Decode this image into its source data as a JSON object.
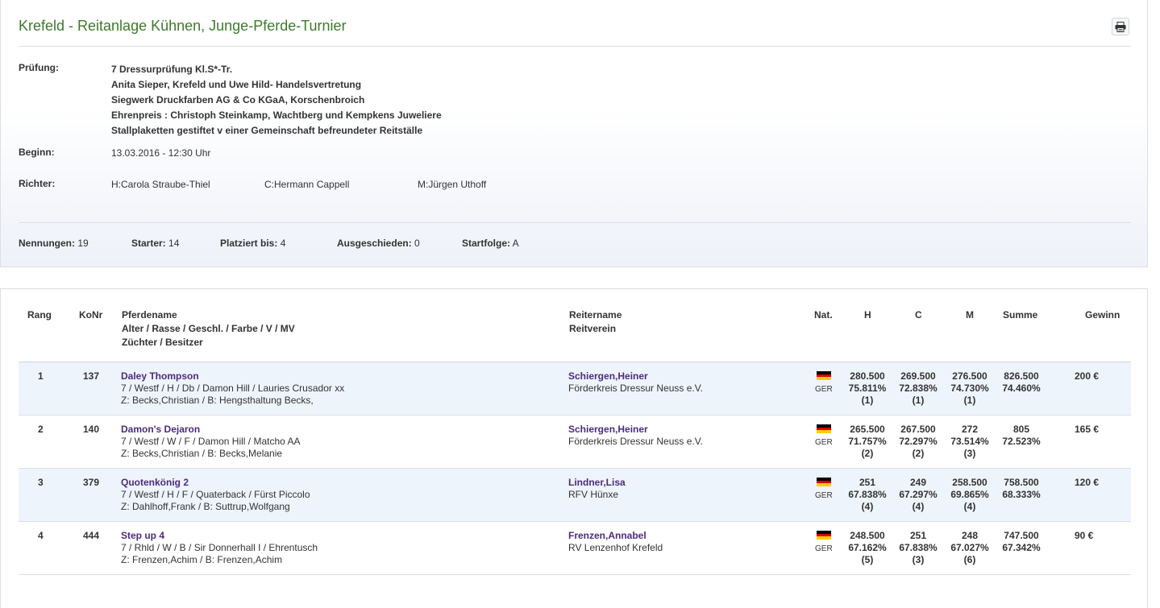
{
  "title": "Krefeld - Reitanlage Kühnen, Junge-Pferde-Turnier",
  "info": {
    "pruefung_label": "Prüfung:",
    "pruefung_lines": [
      "7 Dressurprüfung Kl.S*-Tr.",
      "Anita Sieper, Krefeld und Uwe Hild- Handelsvertretung",
      "Siegwerk Druckfarben AG & Co KGaA, Korschenbroich",
      "Ehrenpreis : Christoph Steinkamp, Wachtberg und Kempkens Juweliere",
      "Stallplaketten gestiftet v einer Gemeinschaft befreundeter Reitställe"
    ],
    "beginn_label": "Beginn:",
    "beginn_value": "13.03.2016 - 12:30 Uhr",
    "richter_label": "Richter:",
    "richter": [
      "H:Carola Straube-Thiel",
      "C:Hermann Cappell",
      "M:Jürgen Uthoff"
    ]
  },
  "stats": [
    {
      "label": "Nennungen:",
      "value": "19"
    },
    {
      "label": "Starter:",
      "value": "14"
    },
    {
      "label": "Platziert bis:",
      "value": "4"
    },
    {
      "label": "Ausgeschieden:",
      "value": "0"
    },
    {
      "label": "Startfolge:",
      "value": "A"
    }
  ],
  "table": {
    "headers": {
      "rang": "Rang",
      "konr": "KoNr",
      "pferd1": "Pferdename",
      "pferd2": "Alter / Rasse / Geschl. / Farbe / V / MV",
      "pferd3": "Züchter / Besitzer",
      "reiter1": "Reitername",
      "reiter2": "Reitverein",
      "nat": "Nat.",
      "h": "H",
      "c": "C",
      "m": "M",
      "summe": "Summe",
      "gewinn": "Gewinn"
    },
    "rows": [
      {
        "rang": "1",
        "konr": "137",
        "pferd": "Daley Thompson",
        "details": "7 / Westf / H / Db / Damon Hill / Lauries Crusador xx",
        "zb": "Z: Becks,Christian / B: Hengsthaltung Becks,",
        "reiter": "Schiergen,Heiner",
        "verein": "Förderkreis Dressur Neuss e.V.",
        "nat": "GER",
        "h": [
          "280.500",
          "75.811%",
          "(1)"
        ],
        "c": [
          "269.500",
          "72.838%",
          "(1)"
        ],
        "m": [
          "276.500",
          "74.730%",
          "(1)"
        ],
        "summe": [
          "826.500",
          "74.460%"
        ],
        "gewinn": "200 €"
      },
      {
        "rang": "2",
        "konr": "140",
        "pferd": "Damon's Dejaron",
        "details": "7 / Westf / W / F / Damon Hill / Matcho AA",
        "zb": "Z: Becks,Christian / B: Becks,Melanie",
        "reiter": "Schiergen,Heiner",
        "verein": "Förderkreis Dressur Neuss e.V.",
        "nat": "GER",
        "h": [
          "265.500",
          "71.757%",
          "(2)"
        ],
        "c": [
          "267.500",
          "72.297%",
          "(2)"
        ],
        "m": [
          "272",
          "73.514%",
          "(3)"
        ],
        "summe": [
          "805",
          "72.523%"
        ],
        "gewinn": "165 €"
      },
      {
        "rang": "3",
        "konr": "379",
        "pferd": "Quotenkönig 2",
        "details": "7 / Westf / H / F / Quaterback / Fürst Piccolo",
        "zb": "Z: Dahlhoff,Frank / B: Suttrup,Wolfgang",
        "reiter": "Lindner,Lisa",
        "verein": "RFV Hünxe",
        "nat": "GER",
        "h": [
          "251",
          "67.838%",
          "(4)"
        ],
        "c": [
          "249",
          "67.297%",
          "(4)"
        ],
        "m": [
          "258.500",
          "69.865%",
          "(4)"
        ],
        "summe": [
          "758.500",
          "68.333%"
        ],
        "gewinn": "120 €"
      },
      {
        "rang": "4",
        "konr": "444",
        "pferd": "Step up 4",
        "details": "7 / Rhld / W / B / Sir Donnerhall I / Ehrentusch",
        "zb": "Z: Frenzen,Achim / B: Frenzen,Achim",
        "reiter": "Frenzen,Annabel",
        "verein": "RV Lenzenhof Krefeld",
        "nat": "GER",
        "h": [
          "248.500",
          "67.162%",
          "(5)"
        ],
        "c": [
          "251",
          "67.838%",
          "(3)"
        ],
        "m": [
          "248",
          "67.027%",
          "(6)"
        ],
        "summe": [
          "747.500",
          "67.342%"
        ],
        "gewinn": "90 €"
      }
    ]
  },
  "colors": {
    "title": "#3d7a2a",
    "link": "#4a2c7e",
    "row_alt": "#eef4fb"
  }
}
